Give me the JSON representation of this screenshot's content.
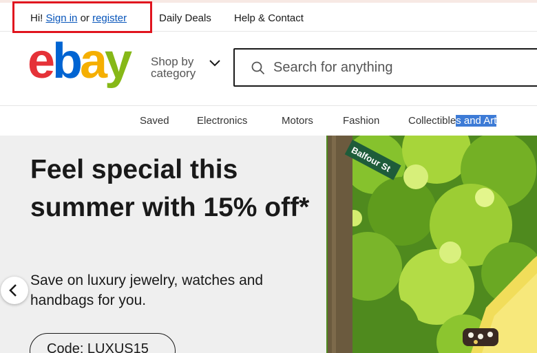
{
  "topbar": {
    "greeting_prefix": "Hi!",
    "sign_in": "Sign in",
    "or": "or",
    "register": "register",
    "daily_deals": "Daily Deals",
    "help_contact": "Help & Contact"
  },
  "header": {
    "shop_by_line1": "Shop by",
    "shop_by_line2": "category",
    "search_placeholder": "Search for anything"
  },
  "nav": {
    "items": [
      "Saved",
      "Electronics",
      "Motors",
      "Fashion"
    ],
    "collectibles_plain": "Collectible",
    "collectibles_highlight": "s and Art"
  },
  "hero": {
    "title": "Feel special this summer with 15% off*",
    "subtitle": "Save on luxury jewelry, watches and handbags for you.",
    "code": "Code: LUXUS15",
    "street_sign": "Balfour St"
  },
  "colors": {
    "link": "#0654ba",
    "highlight_box": "#e0141e",
    "logo_red": "#e53238",
    "logo_blue": "#0064d2",
    "logo_yellow": "#f5af02",
    "logo_green": "#86b817"
  }
}
